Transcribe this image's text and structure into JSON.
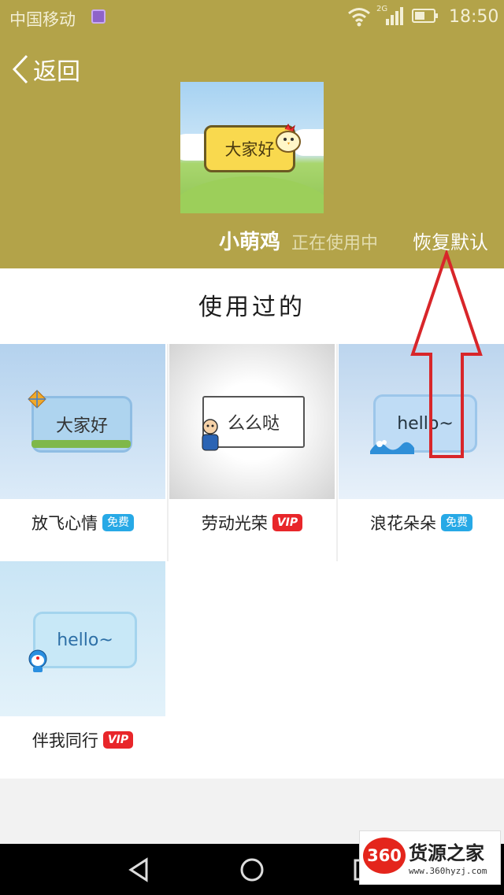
{
  "status_bar": {
    "carrier": "中国移动",
    "network_type": "2G",
    "time": "18:50"
  },
  "header": {
    "back_label": "返回",
    "current_theme": {
      "preview_text": "大家好",
      "name": "小萌鸡",
      "status": "正在使用中"
    },
    "restore_label": "恢复默认"
  },
  "section": {
    "title": "使用过的"
  },
  "bubbles": [
    {
      "preview_text": "大家好",
      "name": "放飞心情",
      "badge": "免费",
      "badge_type": "free"
    },
    {
      "preview_text": "么么哒",
      "name": "劳动光荣",
      "badge": "VIP",
      "badge_type": "vip"
    },
    {
      "preview_text": "hello~",
      "name": "浪花朵朵",
      "badge": "免费",
      "badge_type": "free"
    },
    {
      "preview_text": "hello~",
      "name": "伴我同行",
      "badge": "VIP",
      "badge_type": "vip"
    }
  ],
  "watermark": {
    "logo_text": "360",
    "title": "货源之家",
    "url": "www.360hyzj.com"
  },
  "colors": {
    "header_bg": "#b3a349",
    "free_badge": "#27a9e6",
    "vip_badge": "#e8262a",
    "annotation_arrow": "#d8262a"
  },
  "icons": {
    "back": "chevron-left-icon",
    "wifi": "wifi-icon",
    "signal": "signal-icon",
    "battery": "battery-icon",
    "nav_back": "triangle-back-icon",
    "nav_home": "circle-home-icon",
    "nav_recent": "square-recent-icon"
  }
}
